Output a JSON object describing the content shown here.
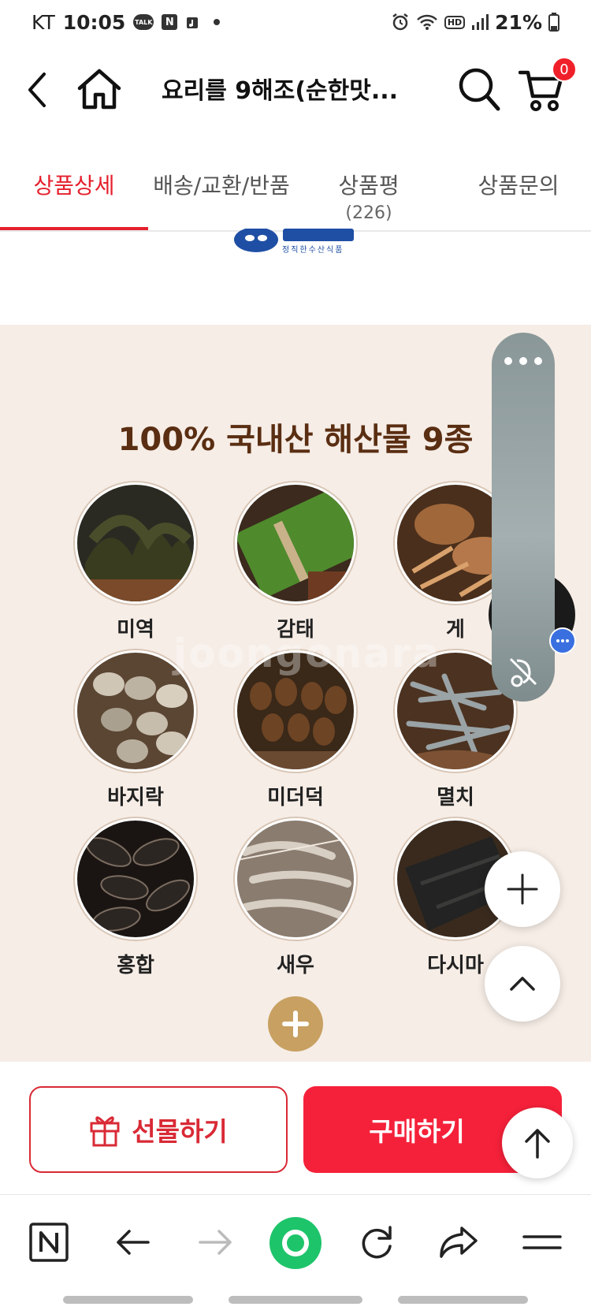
{
  "status_bar": {
    "carrier": "KT",
    "time": "10:05",
    "talk_badge": "TALK",
    "n_badge": "N",
    "hd_badge": "HD",
    "battery": "21%"
  },
  "header": {
    "title": "요리를 9해조(순한맛...",
    "cart_count": "0"
  },
  "tabs": [
    {
      "label": "상품상세",
      "sub": ""
    },
    {
      "label": "배송/교환/반품",
      "sub": ""
    },
    {
      "label": "상품평",
      "sub": "(226)"
    },
    {
      "label": "상품문의",
      "sub": ""
    }
  ],
  "logo": {
    "tagline": "정직한수산식품"
  },
  "content": {
    "heading": "100% 국내산 해산물 9종",
    "watermark": "joongonara",
    "items": [
      {
        "label": "미역",
        "icon": "seaweed-photo"
      },
      {
        "label": "감태",
        "icon": "gamtae-photo"
      },
      {
        "label": "게",
        "icon": "crab-photo"
      },
      {
        "label": "바지락",
        "icon": "clam-photo"
      },
      {
        "label": "미더덕",
        "icon": "sea-squirt-photo"
      },
      {
        "label": "멸치",
        "icon": "anchovy-photo"
      },
      {
        "label": "홍합",
        "icon": "mussel-photo"
      },
      {
        "label": "새우",
        "icon": "shrimp-photo"
      },
      {
        "label": "다시마",
        "icon": "kelp-photo"
      }
    ]
  },
  "actions": {
    "gift_label": "선물하기",
    "buy_label": "구매하기"
  },
  "colors": {
    "accent_red": "#e5202d",
    "buy_red": "#f5213a",
    "panel_bg": "#f6ede6",
    "heading_brown": "#5a2e12",
    "expand_gold": "#c8a061"
  }
}
